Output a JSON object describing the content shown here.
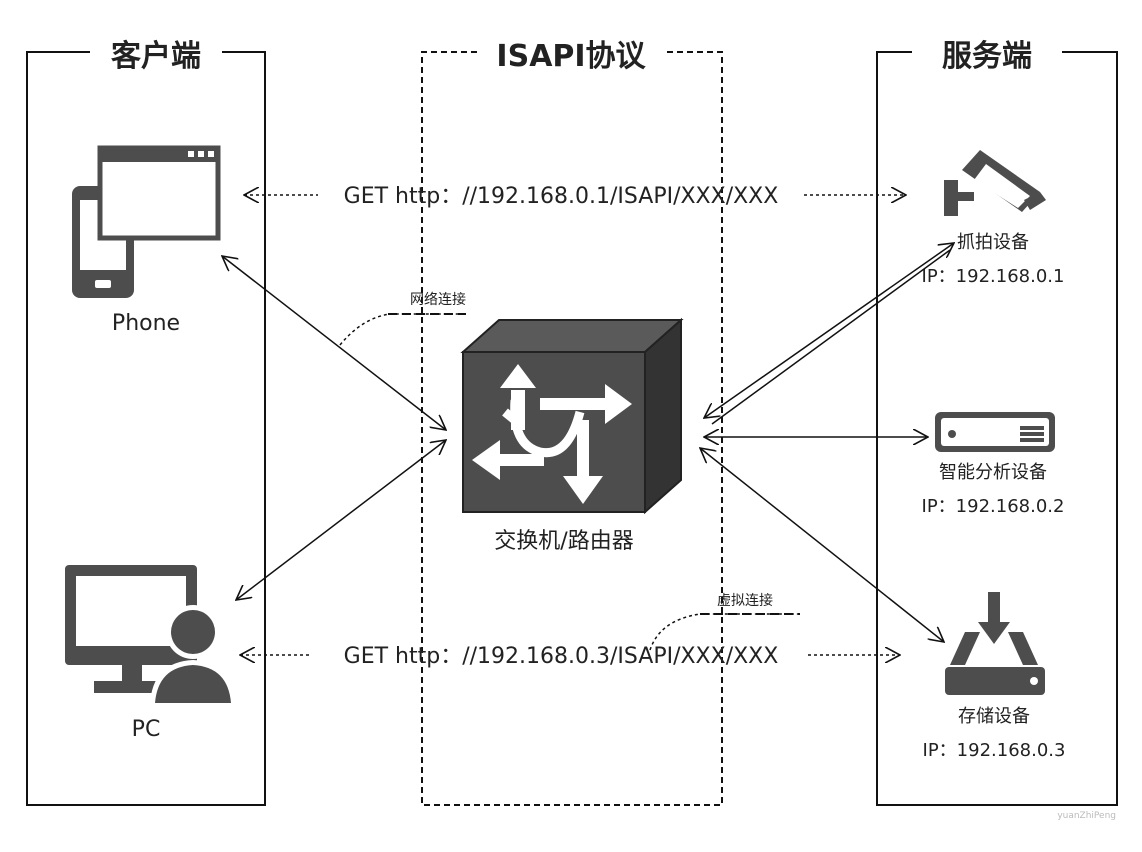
{
  "panels": {
    "client_title": "客户端",
    "protocol_title": "ISAPI协议",
    "server_title": "服务端"
  },
  "client": {
    "phone_label": "Phone",
    "pc_label": "PC"
  },
  "router": {
    "label": "交换机/路由器"
  },
  "requests": {
    "top": "GET http：//192.168.0.1/ISAPI/XXX/XXX",
    "bottom": "GET http：//192.168.0.3/ISAPI/XXX/XXX"
  },
  "annotations": {
    "network": "网络连接",
    "virtual": "虚拟连接"
  },
  "devices": {
    "camera": {
      "name": "抓拍设备",
      "ip": "IP：192.168.0.1"
    },
    "analysis": {
      "name": "智能分析设备",
      "ip": "IP：192.168.0.2"
    },
    "storage": {
      "name": "存储设备",
      "ip": "IP：192.168.0.3"
    }
  },
  "watermark": "yuanZhiPeng",
  "colors": {
    "icon": "#4d4d4d",
    "line": "#111111"
  }
}
